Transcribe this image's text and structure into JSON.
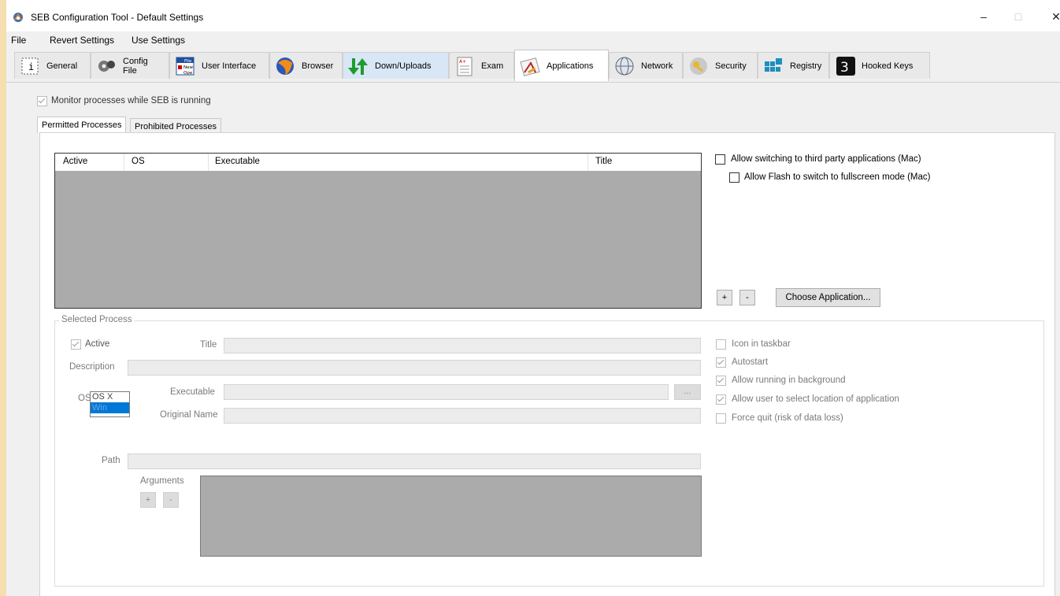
{
  "window": {
    "title": "SEB Configuration Tool - Default Settings",
    "controls": {
      "minimize": "–",
      "maximize": "□",
      "close": "✕"
    }
  },
  "menu": [
    "File",
    "Revert Settings",
    "Use Settings"
  ],
  "tabs": [
    {
      "label": "General",
      "icon": "general-icon"
    },
    {
      "label": "Config File",
      "icon": "config-file-icon"
    },
    {
      "label": "User Interface",
      "icon": "user-interface-icon",
      "icon_text": [
        "File",
        "New",
        "Ope"
      ]
    },
    {
      "label": "Browser",
      "icon": "browser-icon"
    },
    {
      "label": "Down/Uploads",
      "icon": "down-uploads-icon"
    },
    {
      "label": "Exam",
      "icon": "exam-icon"
    },
    {
      "label": "Applications",
      "icon": "applications-icon"
    },
    {
      "label": "Network",
      "icon": "network-icon"
    },
    {
      "label": "Security",
      "icon": "security-icon"
    },
    {
      "label": "Registry",
      "icon": "registry-icon"
    },
    {
      "label": "Hooked Keys",
      "icon": "hooked-keys-icon"
    }
  ],
  "active_tab": "Applications",
  "monitor_processes": {
    "label": "Monitor processes while SEB is running",
    "checked": true,
    "enabled": false
  },
  "subtabs": [
    "Permitted Processes",
    "Prohibited Processes"
  ],
  "process_table": {
    "columns": [
      "Active",
      "OS",
      "Executable",
      "Title"
    ],
    "rows": []
  },
  "options_mac": {
    "allow_switching": {
      "label": "Allow switching to third party applications (Mac)",
      "checked": false
    },
    "allow_flash": {
      "label": "Allow Flash to switch to fullscreen mode (Mac)",
      "checked": false
    }
  },
  "list_buttons": {
    "add": "+",
    "remove": "-",
    "choose": "Choose Application..."
  },
  "selected_process": {
    "group_title": "Selected Process",
    "active": {
      "label": "Active",
      "checked": true
    },
    "title_label": "Title",
    "description_label": "Description",
    "os_label": "OS",
    "os_options": [
      "OS X",
      "Win"
    ],
    "os_selected_index": 1,
    "executable_label": "Executable",
    "browse_label": "...",
    "original_name_label": "Original Name",
    "path_label": "Path",
    "arguments_label": "Arguments",
    "arg_add": "+",
    "arg_remove": "-",
    "options": [
      {
        "label": "Icon in taskbar",
        "checked": false
      },
      {
        "label": "Autostart",
        "checked": true
      },
      {
        "label": "Allow running in background",
        "checked": true
      },
      {
        "label": "Allow user to select location of application",
        "checked": true
      },
      {
        "label": "Force quit (risk of data loss)",
        "checked": false
      }
    ]
  }
}
